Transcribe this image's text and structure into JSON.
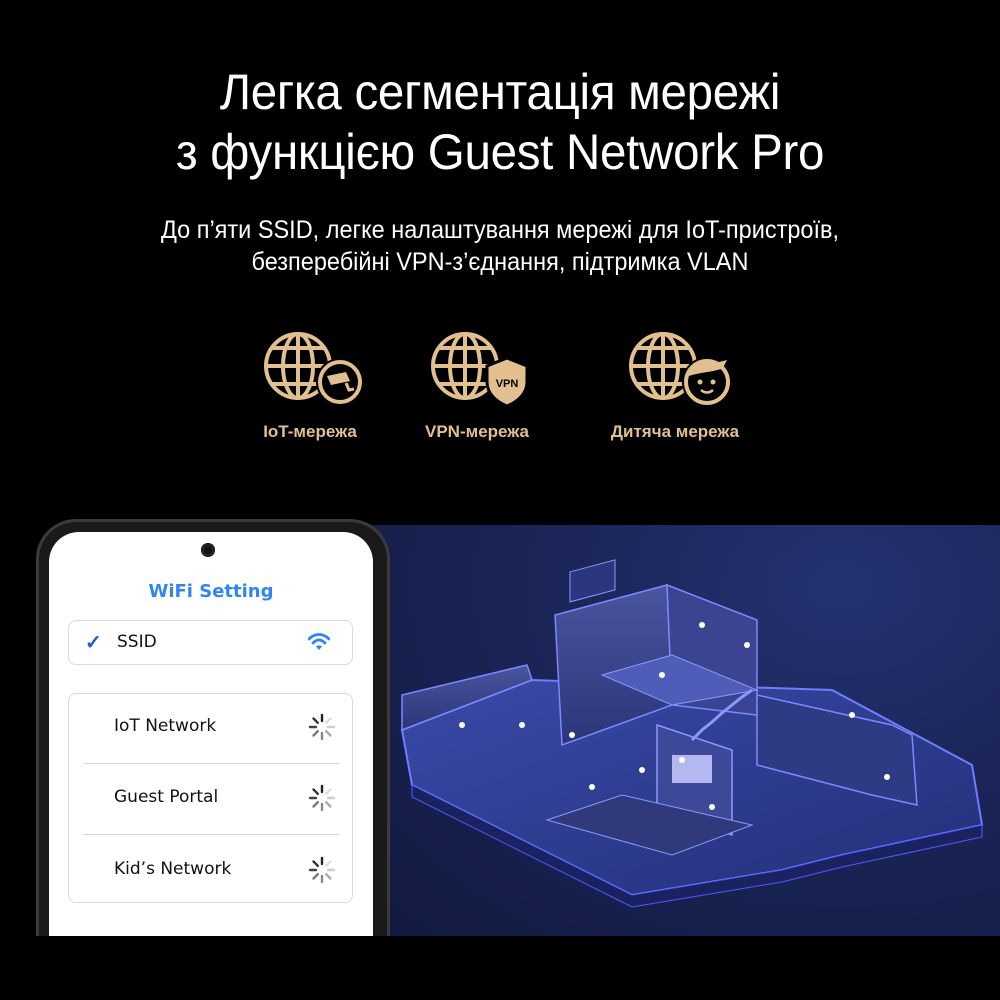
{
  "header": {
    "title_line1": "Легка сегментація мережі",
    "title_line2": "з функцією Guest Network Pro",
    "subtitle_line1": "До п’яти SSID, легке налаштування мережі для IoT-пристроїв,",
    "subtitle_line2": "безперебійні VPN-з’єднання, підтримка VLAN"
  },
  "features": [
    {
      "label": "IoT-мережа",
      "icon": "globe-camera-icon"
    },
    {
      "label": "VPN-мережа",
      "icon": "globe-vpn-shield-icon",
      "badge": "VPN"
    },
    {
      "label": "Дитяча мережа",
      "icon": "globe-kid-face-icon"
    }
  ],
  "colors": {
    "accent_gold": "#e2bf8f",
    "app_blue": "#2f86f2",
    "check_blue": "#1a5fd6",
    "scene_blue": "#1e2a5e"
  },
  "phone": {
    "screen_title": "WiFi Setting",
    "ssid": {
      "label": "SSID",
      "selected": true,
      "status_icon": "wifi-icon"
    },
    "networks": [
      {
        "label": "IoT Network",
        "status_icon": "loading-spinner-icon"
      },
      {
        "label": "Guest Portal",
        "status_icon": "loading-spinner-icon"
      },
      {
        "label": "Kid’s Network",
        "status_icon": "loading-spinner-icon"
      }
    ]
  },
  "scene": {
    "description": "isometric smart home with connected devices"
  }
}
